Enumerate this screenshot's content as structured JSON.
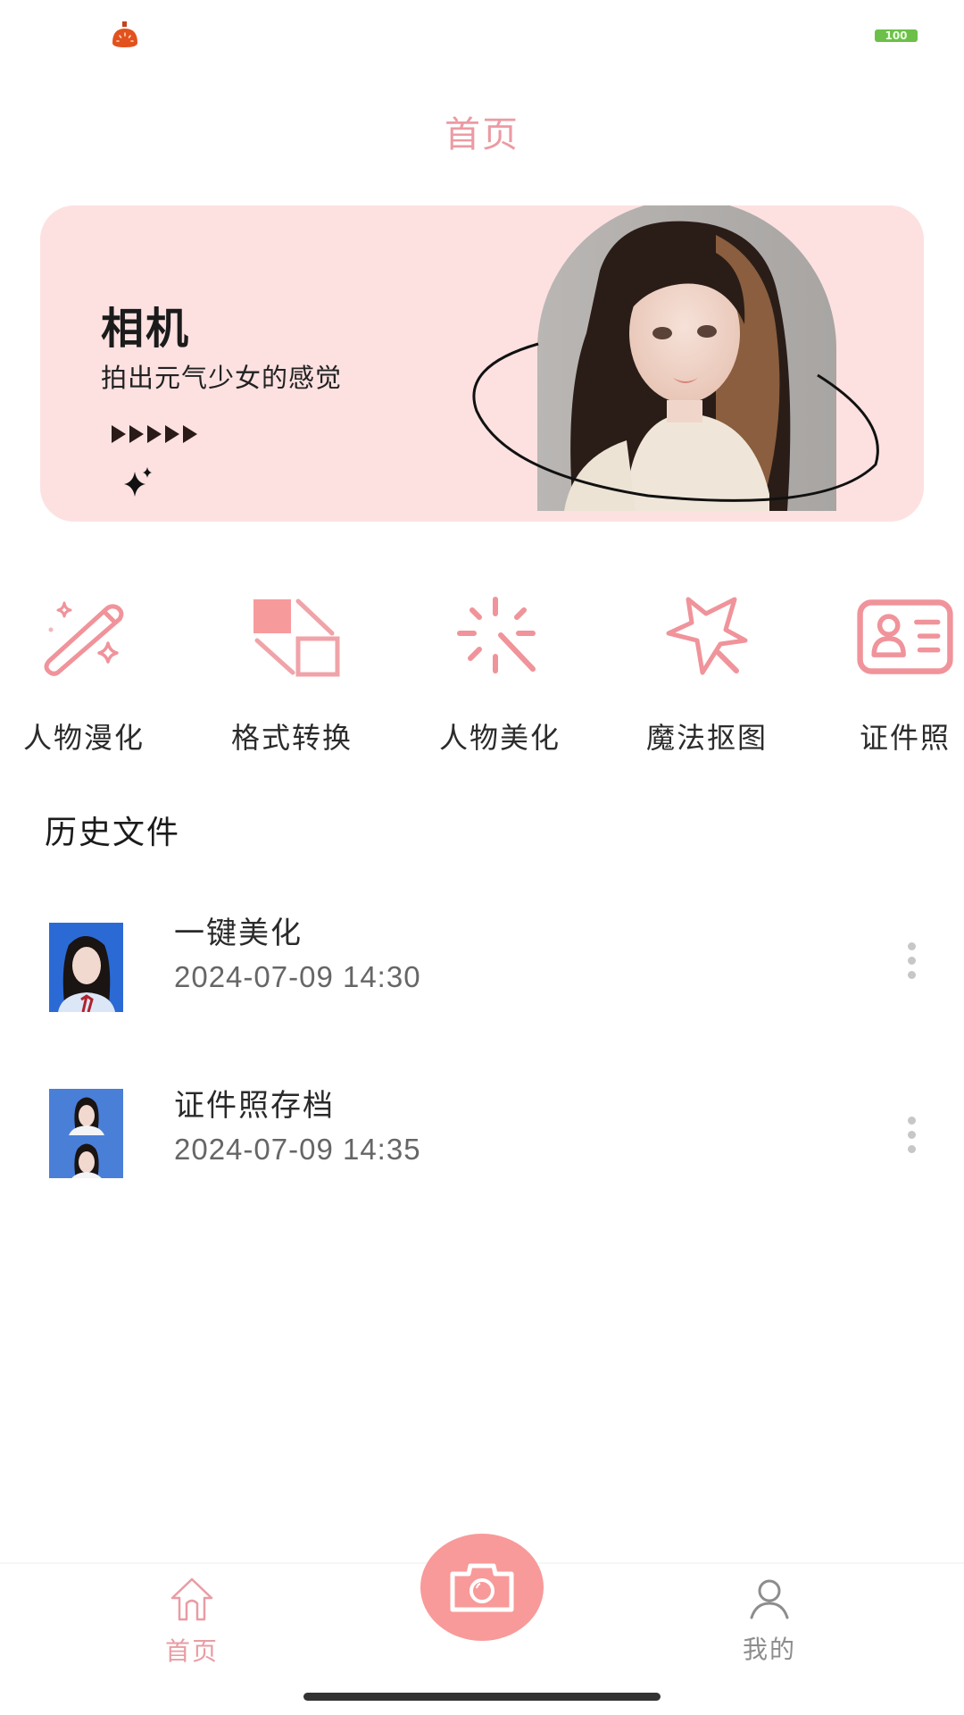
{
  "status_bar": {
    "app_icon": "tomato-app-icon",
    "battery_level": "100",
    "battery_color": "#6cc04a"
  },
  "header": {
    "title": "首页",
    "title_color": "#ec9aa3"
  },
  "banner": {
    "title": "相机",
    "subtitle": "拍出元气少女的感觉",
    "background": "#fde1e1",
    "image": "portrait-photo-girl"
  },
  "features": [
    {
      "label": "人物漫化",
      "icon": "magic-wand-icon"
    },
    {
      "label": "格式转换",
      "icon": "format-convert-icon"
    },
    {
      "label": "人物美化",
      "icon": "sparkle-burst-icon"
    },
    {
      "label": "魔法抠图",
      "icon": "star-wand-icon"
    },
    {
      "label": "证件照",
      "icon": "id-card-icon"
    }
  ],
  "accent_color": "#f0939a",
  "history": {
    "title": "历史文件",
    "items": [
      {
        "title": "一键美化",
        "date": "2024-07-09 14:30",
        "thumbnail": "id-photo-single"
      },
      {
        "title": "证件照存档",
        "date": "2024-07-09 14:35",
        "thumbnail": "id-photo-double"
      }
    ]
  },
  "tab_bar": {
    "home_label": "首页",
    "mine_label": "我的",
    "camera_color": "#f89a99",
    "active_tab": "首页"
  }
}
